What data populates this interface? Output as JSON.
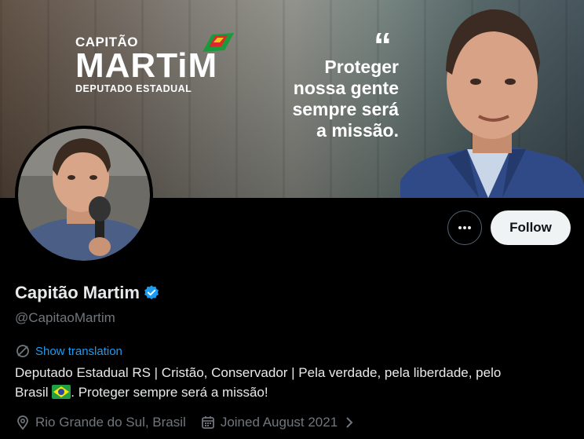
{
  "banner": {
    "logo_top": "CAPITÃO",
    "logo_main": "MARTiM",
    "logo_sub": "DEPUTADO ESTADUAL",
    "slogan_lines": [
      "Proteger",
      "nossa gente",
      "sempre será",
      "a missão."
    ]
  },
  "profile": {
    "name": "Capitão Martim",
    "handle": "@CapitaoMartim",
    "show_translation": "Show translation",
    "bio_line1": "Deputado Estadual RS | Cristão, Conservador | Pela verdade, pela liberdade, pelo",
    "bio_line2_a": "Brasil",
    "bio_line2_b": ". Proteger sempre será a missão!",
    "location": "Rio Grande do Sul, Brasil",
    "joined": "Joined August 2021"
  },
  "actions": {
    "follow_label": "Follow"
  },
  "colors": {
    "accent": "#1d9bf0",
    "muted": "#71767b",
    "text": "#e7e9ea",
    "background": "#000000",
    "follow_bg": "#eff3f4"
  },
  "icons": [
    "more-icon",
    "verified-badge-icon",
    "translate-icon",
    "location-icon",
    "calendar-icon",
    "chevron-right-icon",
    "brazil-flag-icon"
  ]
}
